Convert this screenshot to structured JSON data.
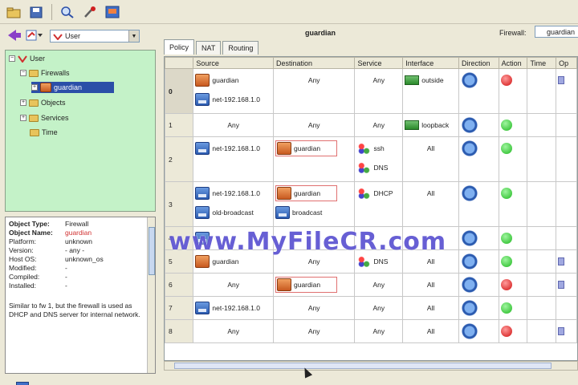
{
  "toolbar": {
    "icons": [
      "open-icon",
      "save-icon",
      "find-icon",
      "tools-icon",
      "install-icon"
    ]
  },
  "left": {
    "library_combo": "User",
    "tree": [
      {
        "label": "User",
        "level": 0
      },
      {
        "label": "Firewalls",
        "level": 1
      },
      {
        "label": "guardian",
        "level": 2
      },
      {
        "label": "Objects",
        "level": 1
      },
      {
        "label": "Services",
        "level": 1
      },
      {
        "label": "Time",
        "level": 1
      }
    ],
    "props": {
      "object_type_key": "Object Type:",
      "object_type_val": "Firewall",
      "object_name_key": "Object Name:",
      "object_name_val": "guardian",
      "platform_key": "Platform:",
      "platform_val": "unknown",
      "version_key": "Version:",
      "version_val": "- any -",
      "hostos_key": "Host OS:",
      "hostos_val": "unknown_os",
      "modified_key": "Modified:",
      "modified_val": "-",
      "compiled_key": "Compiled:",
      "compiled_val": "-",
      "installed_key": "Installed:",
      "installed_val": "-",
      "description": "Similar to fw 1, but the firewall is used as DHCP and DNS server for internal network."
    }
  },
  "right": {
    "title": "guardian",
    "firewall_label": "Firewall:",
    "firewall_value": "guardian",
    "tabs": [
      "Policy",
      "NAT",
      "Routing"
    ],
    "columns": [
      "Source",
      "Destination",
      "Service",
      "Interface",
      "Direction",
      "Action",
      "Time",
      "Op"
    ],
    "rows": [
      {
        "num": "0",
        "source": [
          "guardian",
          "net-192.168.1.0"
        ],
        "destination": [
          "Any"
        ],
        "service": [
          "Any"
        ],
        "interface": "outside",
        "action": "red"
      },
      {
        "num": "1",
        "source": [
          "Any"
        ],
        "destination": [
          "Any"
        ],
        "service": [
          "Any"
        ],
        "interface": "loopback",
        "action": "green"
      },
      {
        "num": "2",
        "source": [
          "net-192.168.1.0"
        ],
        "destination": [
          "guardian"
        ],
        "service": [
          "ssh",
          "DNS"
        ],
        "interface": "All",
        "action": "green"
      },
      {
        "num": "3",
        "source": [
          "net-192.168.1.0",
          "old-broadcast"
        ],
        "destination": [
          "guardian",
          "broadcast"
        ],
        "service": [
          "DHCP"
        ],
        "interface": "All",
        "action": "green"
      },
      {
        "num": "4",
        "source": [
          ""
        ],
        "destination": [
          ""
        ],
        "service": [
          ""
        ],
        "interface": "",
        "action": "green"
      },
      {
        "num": "5",
        "source": [
          "guardian"
        ],
        "destination": [
          "Any"
        ],
        "service": [
          "DNS"
        ],
        "interface": "All",
        "action": "green"
      },
      {
        "num": "6",
        "source": [
          "Any"
        ],
        "destination": [
          "guardian"
        ],
        "service": [
          "Any"
        ],
        "interface": "All",
        "action": "red"
      },
      {
        "num": "7",
        "source": [
          "net-192.168.1.0"
        ],
        "destination": [
          "Any"
        ],
        "service": [
          "Any"
        ],
        "interface": "All",
        "action": "green"
      },
      {
        "num": "8",
        "source": [
          "Any"
        ],
        "destination": [
          "Any"
        ],
        "service": [
          "Any"
        ],
        "interface": "All",
        "action": "red"
      }
    ]
  },
  "watermark": "www.MyFileCR.com"
}
